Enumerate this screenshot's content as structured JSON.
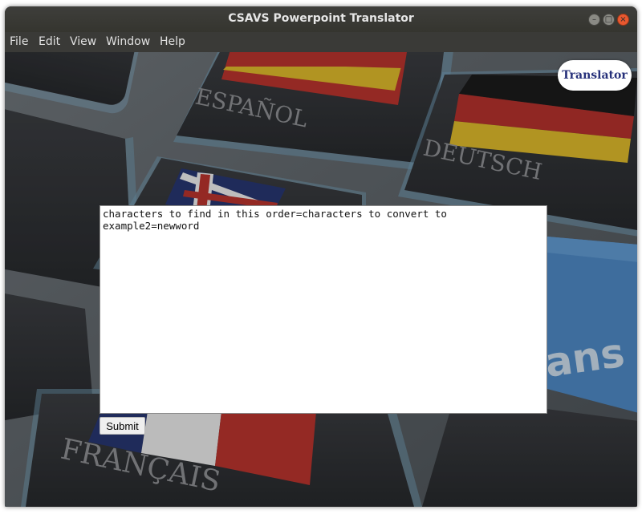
{
  "window": {
    "title": "CSAVS Powerpoint Translator",
    "controls": {
      "minimize": "–",
      "maximize": "□",
      "close": "×"
    }
  },
  "menu": {
    "items": [
      "File",
      "Edit",
      "View",
      "Window",
      "Help"
    ]
  },
  "background": {
    "keys": {
      "spanish": "ESPAÑOL",
      "german": "DEUTSCH",
      "french": "FRANÇAIS",
      "translate_fragment": "ans"
    }
  },
  "badge": {
    "label": "Translator"
  },
  "editor": {
    "value": "characters to find in this order=characters to convert to\nexample2=newword"
  },
  "submit": {
    "label": "Submit"
  },
  "colors": {
    "titlebar": "#3e3e3b",
    "menubar": "#3a3a37",
    "close": "#e9582f",
    "badge_text": "#26307a"
  }
}
